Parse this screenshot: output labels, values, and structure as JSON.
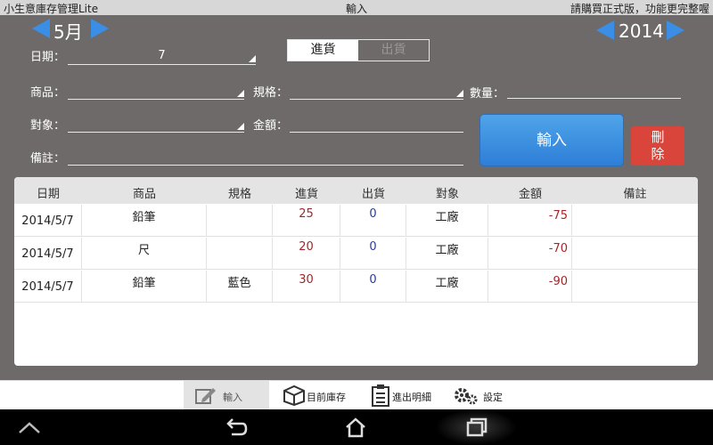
{
  "titlebar": {
    "app_name": "小生意庫存管理Lite",
    "screen": "輸入",
    "promo": "請購買正式版，功能更完整喔"
  },
  "nav": {
    "month": "5月",
    "year": "2014"
  },
  "form": {
    "date_label": "日期：",
    "date_value": "7",
    "product_label": "商品：",
    "product_value": "",
    "spec_label": "規格：",
    "spec_value": "",
    "qty_label": "數量：",
    "qty_value": "",
    "party_label": "對象：",
    "party_value": "",
    "amount_label": "金額：",
    "amount_value": "",
    "note_label": "備註：",
    "note_value": ""
  },
  "toggle": {
    "in_label": "進貨",
    "out_label": "出貨",
    "selected": "進貨"
  },
  "buttons": {
    "input_label": "輸入",
    "delete_label": "刪除"
  },
  "table": {
    "headers": [
      "日期",
      "商品",
      "規格",
      "進貨",
      "出貨",
      "對象",
      "金額",
      "備註"
    ],
    "rows": [
      {
        "date": "2014/5/7",
        "product": "鉛筆",
        "spec": "",
        "in": "25",
        "out": "0",
        "party": "工廠",
        "amount": "-75",
        "note": ""
      },
      {
        "date": "2014/5/7",
        "product": "尺",
        "spec": "",
        "in": "20",
        "out": "0",
        "party": "工廠",
        "amount": "-70",
        "note": ""
      },
      {
        "date": "2014/5/7",
        "product": "鉛筆",
        "spec": "藍色",
        "in": "30",
        "out": "0",
        "party": "工廠",
        "amount": "-90",
        "note": ""
      }
    ]
  },
  "tabs": [
    {
      "label": "輸入",
      "icon": "edit-icon",
      "active": true
    },
    {
      "label": "目前庫存",
      "icon": "box-icon",
      "active": false
    },
    {
      "label": "進出明細",
      "icon": "clipboard-icon",
      "active": false
    },
    {
      "label": "設定",
      "icon": "gears-icon",
      "active": false
    }
  ],
  "colors": {
    "background": "#6e6a69",
    "accent_blue": "#3a8ee6",
    "delete_red": "#d9443b",
    "amount_red": "#a3262a",
    "out_blue": "#2b3d9c"
  }
}
